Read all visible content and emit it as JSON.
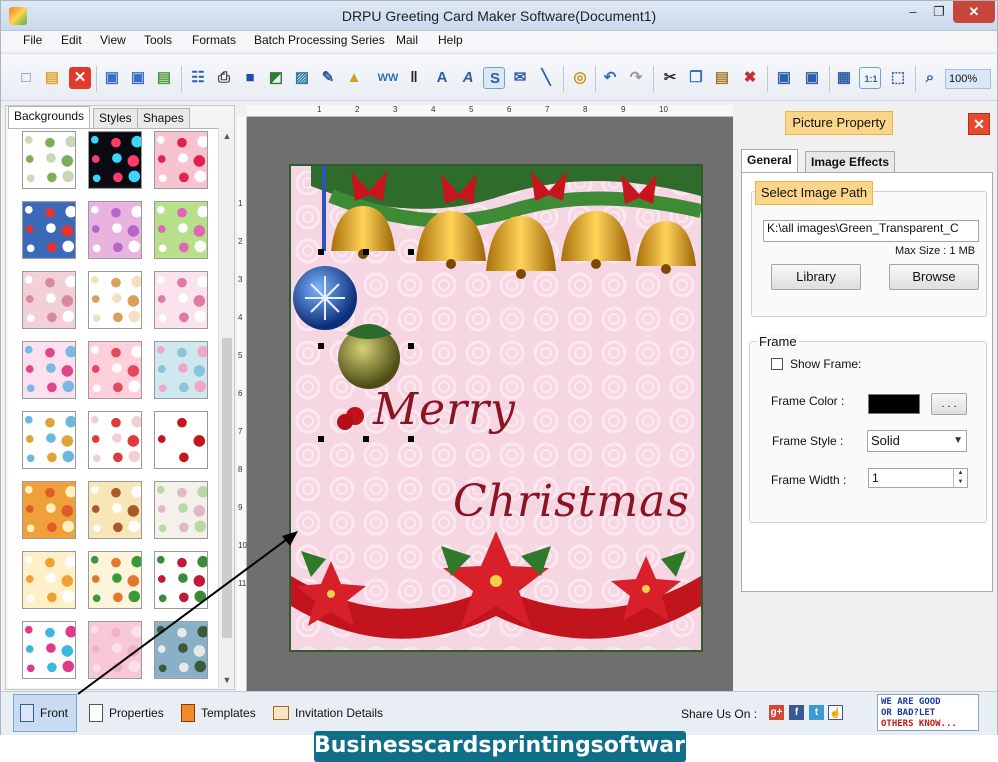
{
  "window": {
    "title": "DRPU Greeting Card Maker Software(Document1)"
  },
  "menu": [
    "File",
    "Edit",
    "View",
    "Tools",
    "Formats",
    "Batch Processing Series",
    "Mail",
    "Help"
  ],
  "toolbar": {
    "zoom": "100%"
  },
  "left_panel": {
    "tabs": [
      "Backgrounds",
      "Styles",
      "Shapes"
    ],
    "active_tab": "Backgrounds"
  },
  "ruler": {
    "top": [
      "1",
      "2",
      "3",
      "4",
      "5",
      "6",
      "7",
      "8",
      "9",
      "10"
    ],
    "left": [
      "1",
      "2",
      "3",
      "4",
      "5",
      "6",
      "7",
      "8",
      "9",
      "10",
      "11"
    ]
  },
  "card": {
    "line1": "Merry",
    "line2": "Christmas"
  },
  "right_panel": {
    "title": "Picture Property",
    "tabs": [
      "General",
      "Image Effects"
    ],
    "select_image_path": "Select Image Path",
    "image_path": "K:\\all images\\Green_Transparent_C",
    "max_size": "Max Size : 1 MB",
    "library_button": "Library",
    "browse_button": "Browse",
    "frame": {
      "legend": "Frame",
      "show_frame_label": "Show Frame:",
      "frame_color_label": "Frame Color :",
      "frame_color_button": ". . .",
      "frame_color": "#000000",
      "frame_style_label": "Frame Style :",
      "frame_style_value": "Solid",
      "frame_width_label": "Frame Width :",
      "frame_width_value": "1"
    }
  },
  "bottom_bar": {
    "tabs": [
      "Front",
      "Properties",
      "Templates",
      "Invitation Details"
    ],
    "share_label": "Share Us On :",
    "feedback": [
      "WE ARE GOOD",
      "OR BAD?LET",
      "OTHERS KNOW..."
    ]
  },
  "watermark": "Businesscardsprintingsoftware.com"
}
